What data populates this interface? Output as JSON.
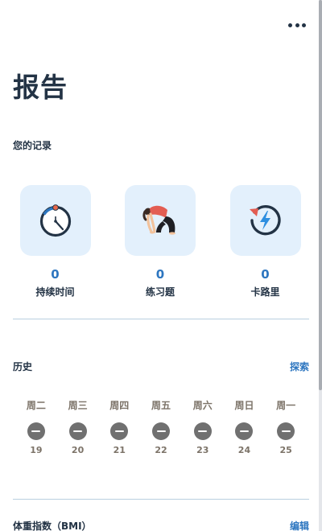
{
  "page": {
    "title": "报告"
  },
  "records": {
    "section_label": "您的记录",
    "items": [
      {
        "value": "0",
        "label": "持续时间",
        "icon": "stopwatch-icon"
      },
      {
        "value": "0",
        "label": "练习题",
        "icon": "yoga-pose-icon"
      },
      {
        "value": "0",
        "label": "卡路里",
        "icon": "calorie-burn-icon"
      }
    ]
  },
  "history": {
    "title": "历史",
    "explore_label": "探索",
    "days": [
      {
        "name": "周二",
        "date": "19"
      },
      {
        "name": "周三",
        "date": "20"
      },
      {
        "name": "周四",
        "date": "21"
      },
      {
        "name": "周五",
        "date": "22"
      },
      {
        "name": "周六",
        "date": "23"
      },
      {
        "name": "周日",
        "date": "24"
      },
      {
        "name": "周一",
        "date": "25"
      }
    ]
  },
  "next_section": {
    "title": "体重指数（BMI）",
    "link_label": "编辑"
  },
  "colors": {
    "accent": "#2d76c0",
    "title": "#233345",
    "card": "#e3f0fc",
    "muted": "#7c7368"
  }
}
